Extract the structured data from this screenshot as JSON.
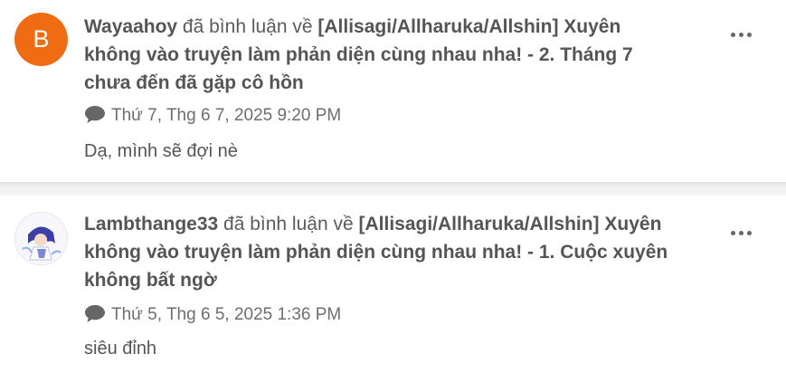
{
  "notifications": [
    {
      "avatar_letter": "B",
      "avatar_color": "#ef6c13",
      "user": "Wayaahoy",
      "action": " đã bình luận về ",
      "story_line1": "[Allisagi/Allharuka/Allshin] Xuyên",
      "story_line2": "không vào truyện làm phản diện cùng nhau nha! - 2. Tháng 7",
      "story_line3": "chưa đến đã gặp cô hồn",
      "time": "Thứ 7, Thg 6 7, 2025 9:20 PM",
      "comment": "Dạ, mình sẽ đợi nè"
    },
    {
      "avatar_letter": "",
      "avatar_color": "#ffffff",
      "user": "Lambthange33",
      "action": " đã bình luận về ",
      "story_line1": "[Allisagi/Allharuka/Allshin] Xuyên",
      "story_line2": "không vào truyện làm phản diện cùng nhau nha! - 1. Cuộc xuyên",
      "story_line3": "không bất ngờ",
      "time": "Thứ 5, Thg 6 5, 2025 1:36 PM",
      "comment": "siêu đỉnh"
    }
  ],
  "icons": {
    "comment": "speech-bubble-icon",
    "more": "more-dots-icon"
  }
}
